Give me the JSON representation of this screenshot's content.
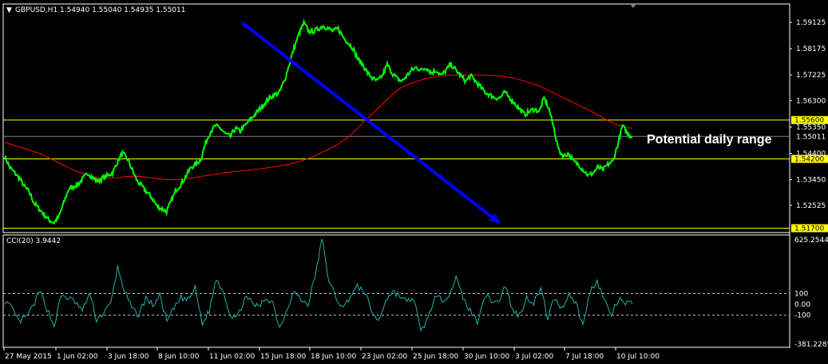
{
  "header": {
    "symbol_text": "GBPUSD,H1  1.54940 1.55040 1.54935 1.55011",
    "indicator_text": "CCI(20) 3.9442"
  },
  "annotation": "Potential daily range",
  "colors": {
    "background": "#000000",
    "price": "#00ff00",
    "ma": "#ff0000",
    "levels": "#ffff00",
    "trend_arrow": "#0000ff",
    "cci": "#20b2aa",
    "axis": "#ffffff"
  },
  "chart_data": [
    {
      "type": "line",
      "title": "GBPUSD,H1",
      "price_axis_ticks": [
        "1.59125",
        "1.58175",
        "1.57225",
        "1.56300",
        "1.55350",
        "1.54400",
        "1.53450",
        "1.52525"
      ],
      "y_range": [
        1.516,
        1.597
      ],
      "time_axis_ticks": [
        "27 May 2015",
        "1 Jun 02:00",
        "3 Jun 18:00",
        "8 Jun 10:00",
        "11 Jun 02:00",
        "15 Jun 18:00",
        "18 Jun 10:00",
        "23 Jun 02:00",
        "25 Jun 18:00",
        "30 Jun 10:00",
        "3 Jul 02:00",
        "7 Jul 18:00",
        "10 Jul 10:00"
      ],
      "series": [
        {
          "values": [
            1.543,
            1.539,
            1.537,
            1.535,
            1.532,
            1.53,
            1.526,
            1.524,
            1.522,
            1.52,
            1.519,
            1.521,
            1.526,
            1.531,
            1.532,
            1.533,
            1.535,
            1.537,
            1.535,
            1.534,
            1.535,
            1.536,
            1.537,
            1.541,
            1.544,
            1.542,
            1.538,
            1.534,
            1.532,
            1.53,
            1.528,
            1.525,
            1.524,
            1.523,
            1.527,
            1.531,
            1.533,
            1.536,
            1.539,
            1.54,
            1.542,
            1.548,
            1.552,
            1.554,
            1.553,
            1.551,
            1.55,
            1.553,
            1.552,
            1.554,
            1.556,
            1.558,
            1.56,
            1.562,
            1.564,
            1.565,
            1.566,
            1.57,
            1.576,
            1.582,
            1.587,
            1.591,
            1.588,
            1.588,
            1.589,
            1.59,
            1.589,
            1.588,
            1.589,
            1.586,
            1.584,
            1.582,
            1.578,
            1.576,
            1.573,
            1.571,
            1.57,
            1.572,
            1.576,
            1.573,
            1.571,
            1.57,
            1.572,
            1.574,
            1.575,
            1.574,
            1.575,
            1.573,
            1.574,
            1.572,
            1.574,
            1.576,
            1.574,
            1.572,
            1.57,
            1.572,
            1.57,
            1.568,
            1.566,
            1.565,
            1.564,
            1.564,
            1.566,
            1.564,
            1.562,
            1.56,
            1.558,
            1.559,
            1.56,
            1.559,
            1.564,
            1.56,
            1.553,
            1.545,
            1.543,
            1.544,
            1.541,
            1.54,
            1.538,
            1.536,
            1.537,
            1.539,
            1.538,
            1.54,
            1.541,
            1.547,
            1.554,
            1.551,
            1.5501
          ]
        },
        {
          "values": [
            1.548,
            1.547,
            1.546,
            1.545,
            1.544,
            1.5425,
            1.541,
            1.5395,
            1.538,
            1.5368,
            1.5358,
            1.5352,
            1.535,
            1.5352,
            1.5356,
            1.5358,
            1.5356,
            1.5352,
            1.5348,
            1.5345,
            1.5345,
            1.5348,
            1.5352,
            1.5358,
            1.5362,
            1.5368,
            1.5372,
            1.5375,
            1.5378,
            1.5382,
            1.5385,
            1.539,
            1.5395,
            1.54,
            1.5408,
            1.5418,
            1.543,
            1.5445,
            1.546,
            1.5478,
            1.55,
            1.553,
            1.556,
            1.559,
            1.562,
            1.565,
            1.5675,
            1.569,
            1.57,
            1.571,
            1.5715,
            1.572,
            1.5722,
            1.5722,
            1.5722,
            1.5722,
            1.5722,
            1.572,
            1.5718,
            1.5712,
            1.5705,
            1.5695,
            1.5685,
            1.567,
            1.5655,
            1.564,
            1.5625,
            1.561,
            1.5595,
            1.5578,
            1.556,
            1.5545,
            1.5535,
            1.553
          ]
        }
      ],
      "horizontal_levels": [
        {
          "value": 1.556,
          "label": "1.55600"
        },
        {
          "value": 1.542,
          "label": "1.54200"
        },
        {
          "value": 1.517,
          "label": "1.51700"
        }
      ],
      "current_price": {
        "value": 1.5501,
        "label": "1.55011"
      },
      "trend_arrow": {
        "from": [
          0.38,
          1.5908
        ],
        "to": [
          0.79,
          1.5186
        ]
      }
    },
    {
      "type": "line",
      "title": "CCI(20) 3.9442",
      "y_ticks": [
        "625.2544",
        "100",
        "0.00",
        "-100",
        "-381.2285"
      ],
      "y_range": [
        -381.2285,
        625.2544
      ],
      "reference_lines": [
        100,
        -100
      ],
      "series": [
        {
          "values": [
            30,
            -40,
            -160,
            -120,
            -20,
            120,
            -40,
            -200,
            80,
            60,
            20,
            -60,
            100,
            -140,
            -80,
            0,
            340,
            120,
            -40,
            -100,
            60,
            -10,
            80,
            -160,
            -40,
            60,
            40,
            150,
            -180,
            -60,
            240,
            120,
            -100,
            -120,
            60,
            20,
            -30,
            60,
            20,
            -220,
            -40,
            120,
            40,
            0,
            260,
            600,
            200,
            60,
            -40,
            80,
            160,
            120,
            -60,
            -160,
            40,
            120,
            80,
            20,
            60,
            -260,
            -120,
            60,
            40,
            100,
            240,
            60,
            -60,
            -160,
            80,
            40,
            20,
            180,
            -60,
            -100,
            60,
            20,
            140,
            -120,
            60,
            -40,
            100,
            10,
            -200,
            120,
            220,
            40,
            -100,
            40,
            10,
            4
          ]
        }
      ]
    }
  ]
}
